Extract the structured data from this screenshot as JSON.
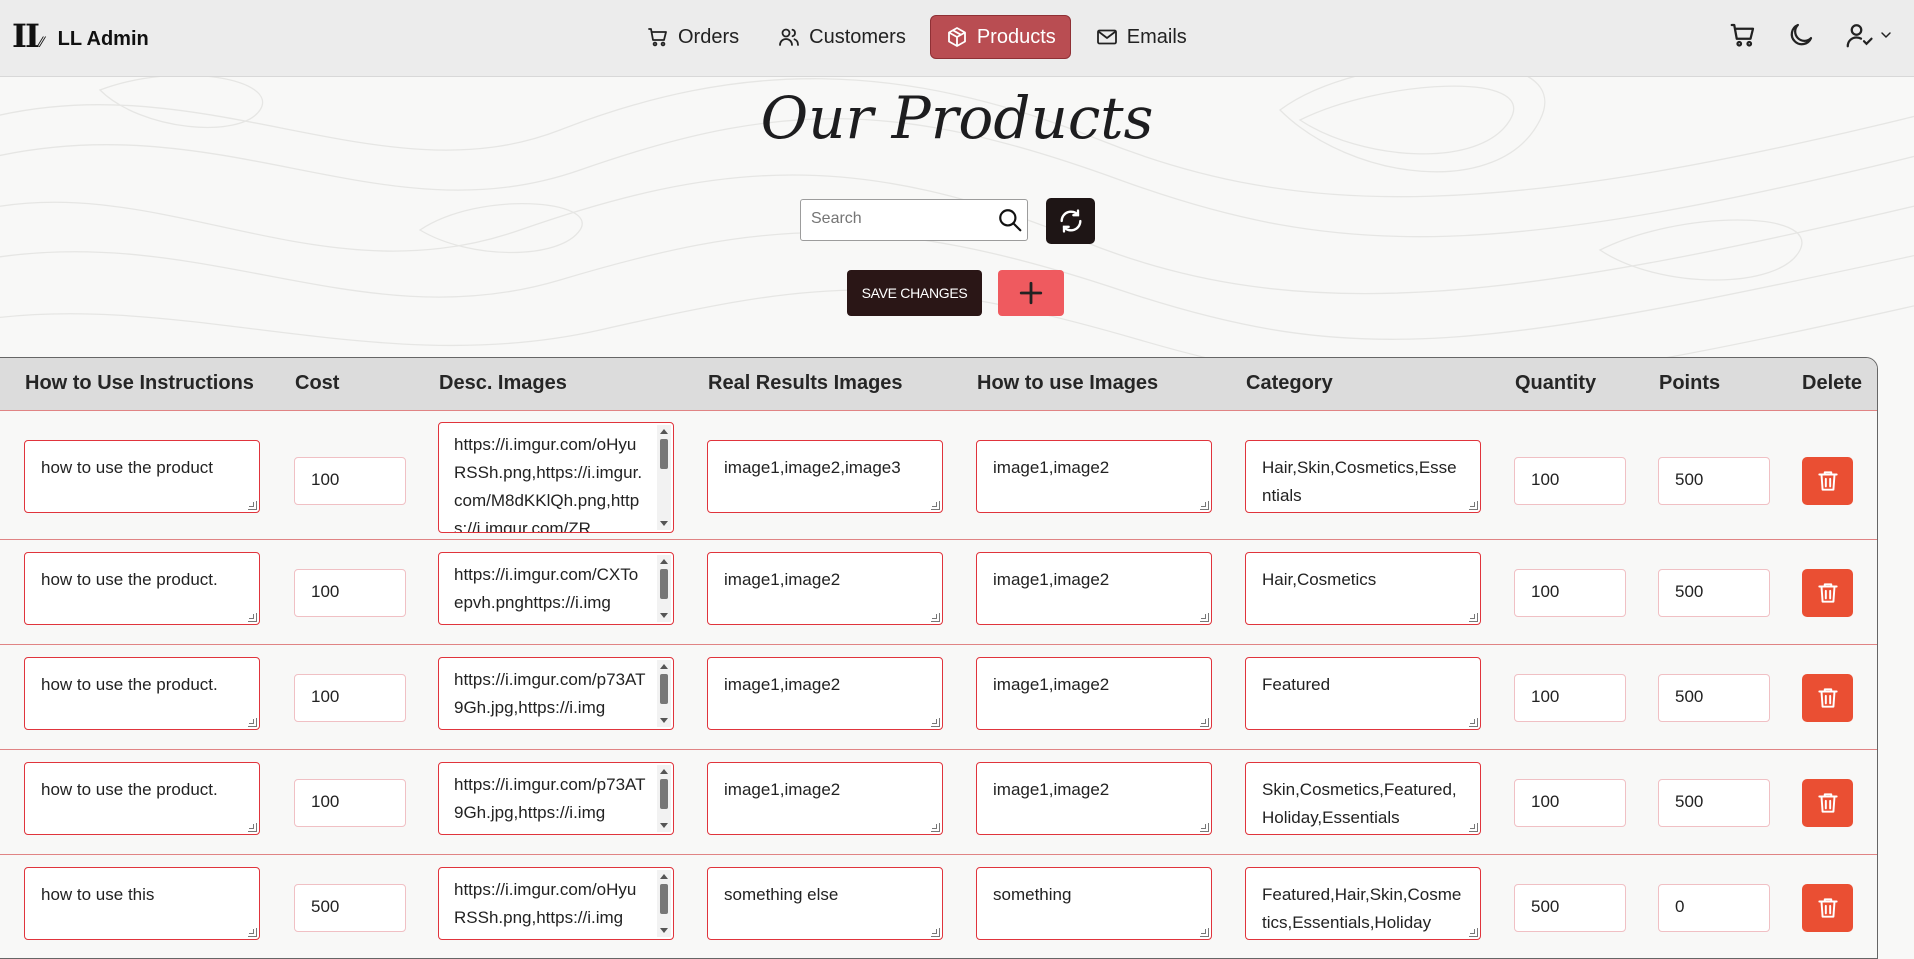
{
  "app": {
    "logo_text": "II",
    "logo_sub": "⁄⁄",
    "name": "LL Admin"
  },
  "nav": [
    {
      "label": "Orders",
      "icon": "cart-icon"
    },
    {
      "label": "Customers",
      "icon": "users-icon"
    },
    {
      "label": "Products",
      "icon": "box-icon",
      "active": true
    },
    {
      "label": "Emails",
      "icon": "mail-icon"
    }
  ],
  "top_actions": [
    "cart-icon",
    "moon-icon",
    "user-icon",
    "chevron-down-icon"
  ],
  "page": {
    "title": "Our Products"
  },
  "search": {
    "placeholder": "Search",
    "value": ""
  },
  "buttons": {
    "save_label": "SAVE CHANGES",
    "add_label": "+"
  },
  "table": {
    "headers": [
      "How to Use Instructions",
      "Cost",
      "Desc. Images",
      "Real Results Images",
      "How to use Images",
      "Category",
      "Quantity",
      "Points",
      "Delete"
    ],
    "rows": [
      {
        "instructions": "how to use the product",
        "cost": "100",
        "desc_images": "https://i.imgur.com/oHyuRSSh.png,https://i.imgur.com/M8dKKlQh.png,https://i.imgur.com/ZR",
        "real_results": "image1,image2,image3",
        "how_to_images": "image1,image2",
        "category": "Hair,Skin,Cosmetics,Essentials",
        "quantity": "100",
        "points": "500"
      },
      {
        "instructions": "how to use the product.",
        "cost": "100",
        "desc_images": "https://i.imgur.com/CXToepvh.pnghttps://i.img",
        "real_results": "image1,image2",
        "how_to_images": "image1,image2",
        "category": "Hair,Cosmetics",
        "quantity": "100",
        "points": "500"
      },
      {
        "instructions": "how to use the product.",
        "cost": "100",
        "desc_images": "https://i.imgur.com/p73AT9Gh.jpg,https://i.img",
        "real_results": "image1,image2",
        "how_to_images": "image1,image2",
        "category": "Featured",
        "quantity": "100",
        "points": "500"
      },
      {
        "instructions": "how to use the product.",
        "cost": "100",
        "desc_images": "https://i.imgur.com/p73AT9Gh.jpg,https://i.img",
        "real_results": "image1,image2",
        "how_to_images": "image1,image2",
        "category": "Skin,Cosmetics,Featured,Holiday,Essentials",
        "quantity": "100",
        "points": "500"
      },
      {
        "instructions": "how to use this",
        "cost": "500",
        "desc_images": "https://i.imgur.com/oHyuRSSh.png,https://i.img",
        "real_results": "something else",
        "how_to_images": "something",
        "category": "Featured,Hair,Skin,Cosmetics,Essentials,Holiday",
        "quantity": "500",
        "points": "0"
      }
    ]
  },
  "colors": {
    "accent": "#b94d52",
    "dark": "#2a1616",
    "add": "#ef5a5f",
    "delete": "#ea4f33",
    "border": "#e0343c"
  }
}
